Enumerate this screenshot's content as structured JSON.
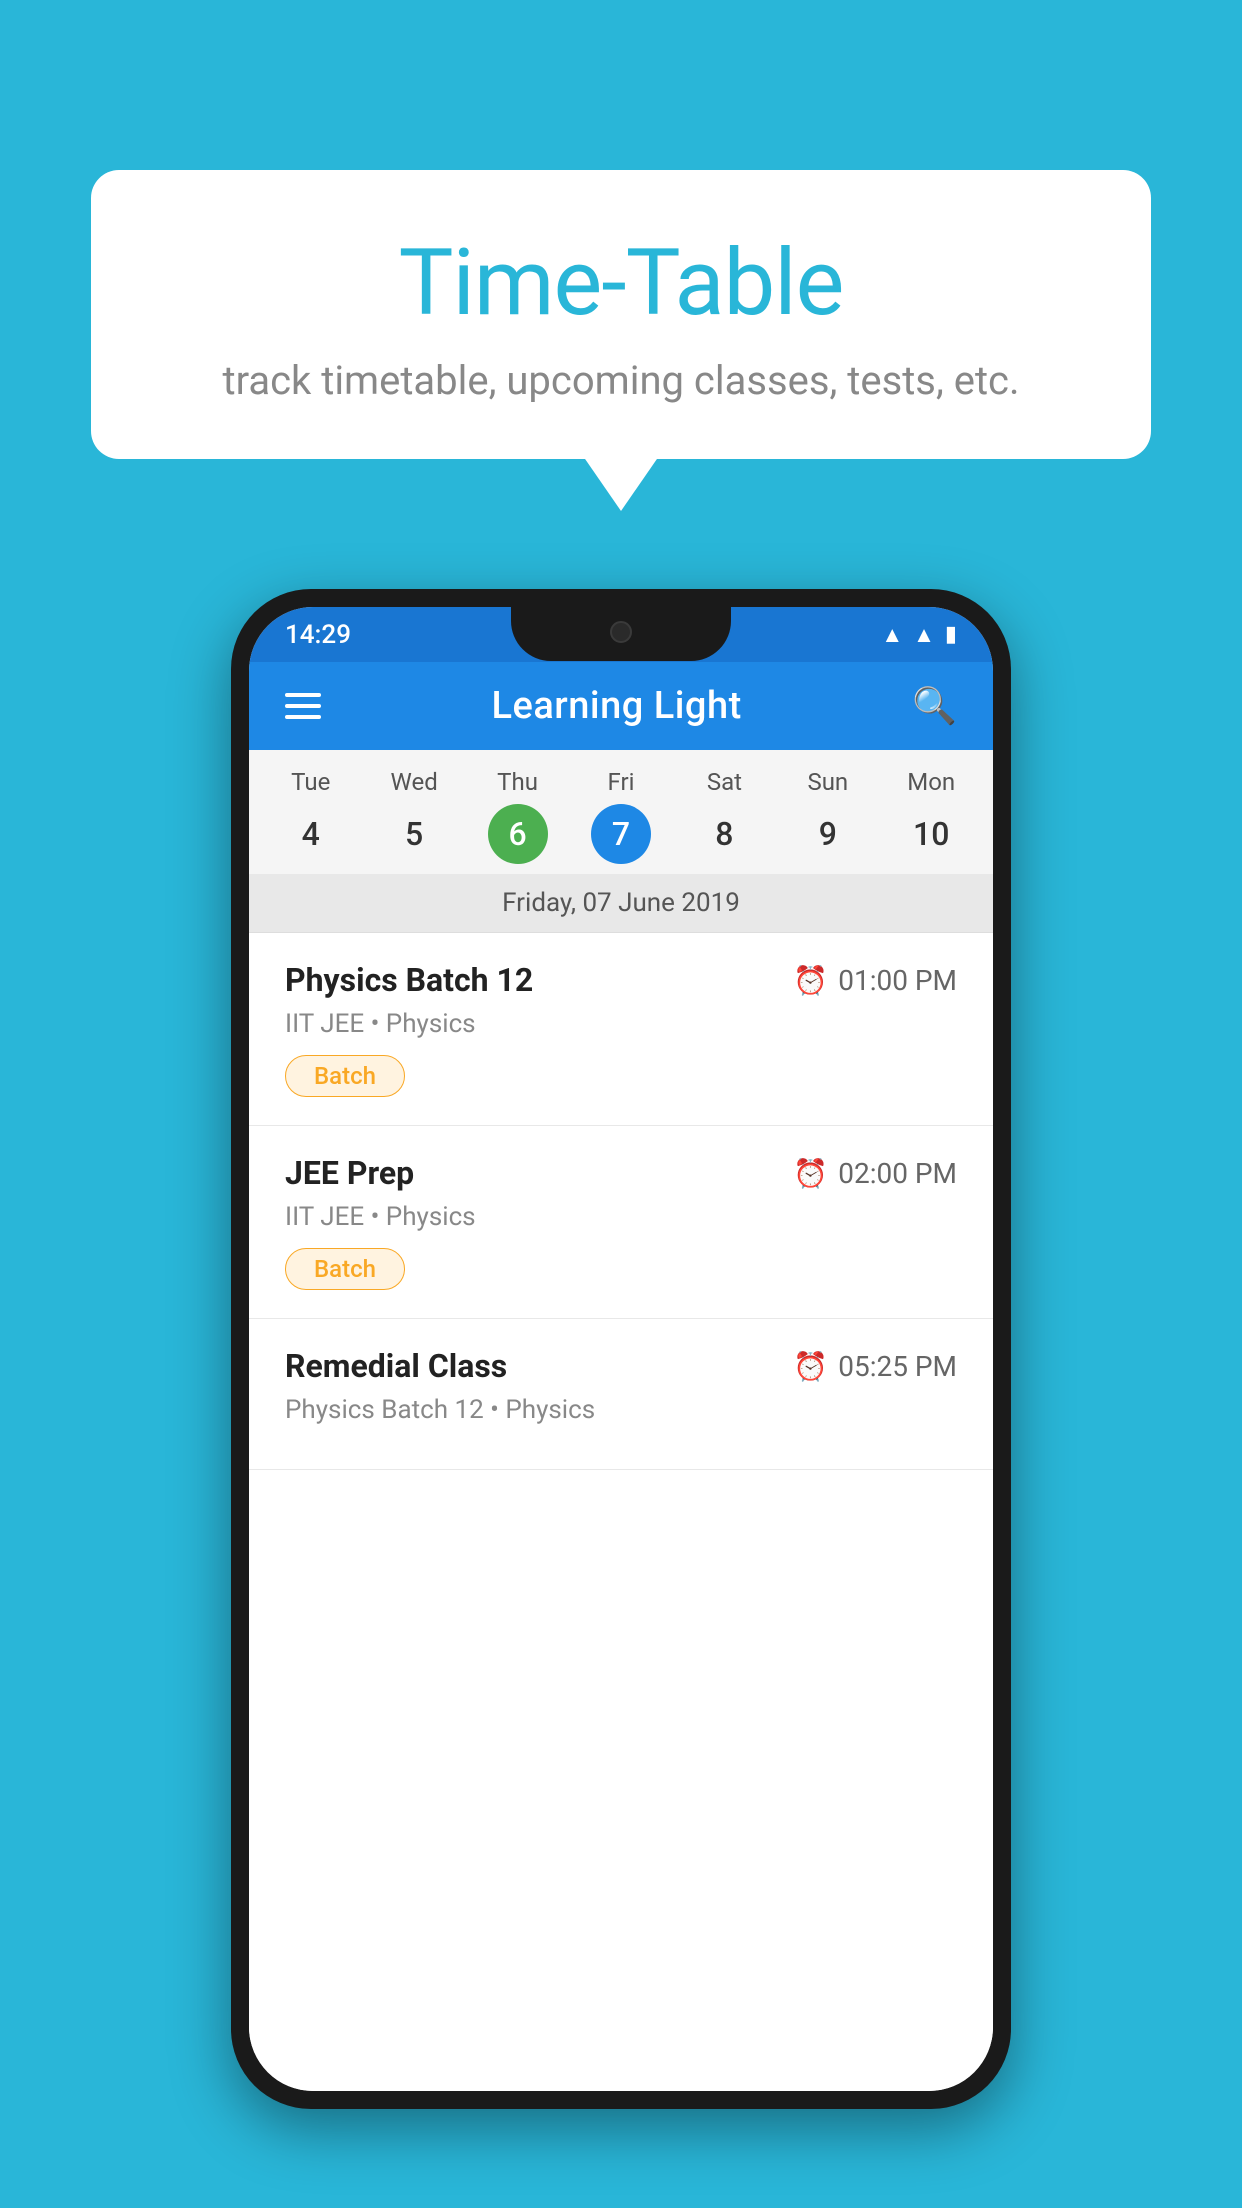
{
  "background_color": "#29B6D8",
  "speech_bubble": {
    "title": "Time-Table",
    "subtitle": "track timetable, upcoming classes, tests, etc."
  },
  "phone": {
    "status_bar": {
      "time": "14:29",
      "icons": [
        "wifi",
        "signal",
        "battery"
      ]
    },
    "app_bar": {
      "title": "Learning Light",
      "menu_icon": "hamburger-icon",
      "search_icon": "search-icon"
    },
    "calendar": {
      "days": [
        {
          "name": "Tue",
          "num": "4",
          "state": "normal"
        },
        {
          "name": "Wed",
          "num": "5",
          "state": "normal"
        },
        {
          "name": "Thu",
          "num": "6",
          "state": "today"
        },
        {
          "name": "Fri",
          "num": "7",
          "state": "selected"
        },
        {
          "name": "Sat",
          "num": "8",
          "state": "normal"
        },
        {
          "name": "Sun",
          "num": "9",
          "state": "normal"
        },
        {
          "name": "Mon",
          "num": "10",
          "state": "normal"
        }
      ],
      "selected_date_label": "Friday, 07 June 2019"
    },
    "schedule_items": [
      {
        "name": "Physics Batch 12",
        "time": "01:00 PM",
        "meta": "IIT JEE • Physics",
        "badge": "Batch"
      },
      {
        "name": "JEE Prep",
        "time": "02:00 PM",
        "meta": "IIT JEE • Physics",
        "badge": "Batch"
      },
      {
        "name": "Remedial Class",
        "time": "05:25 PM",
        "meta": "Physics Batch 12 • Physics",
        "badge": null
      }
    ]
  }
}
